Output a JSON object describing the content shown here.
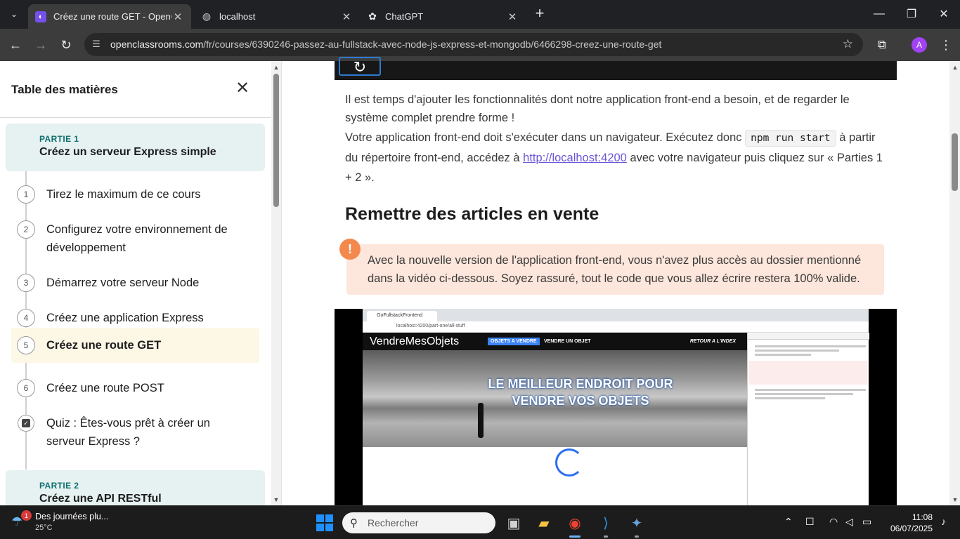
{
  "browser": {
    "tabs": [
      {
        "title": "Créez une route GET - OpenClassrooms",
        "active": true,
        "favicon": "openclassrooms-icon"
      },
      {
        "title": "localhost",
        "active": false,
        "favicon": "globe-icon"
      },
      {
        "title": "ChatGPT",
        "active": false,
        "favicon": "chatgpt-icon"
      }
    ],
    "url_host": "openclassrooms.com",
    "url_path": "/fr/courses/6390246-passez-au-fullstack-avec-node-js-express-et-mongodb/6466298-creez-une-route-get",
    "profile_initial": "A"
  },
  "sidebar": {
    "title": "Table des matières",
    "part1": {
      "label": "PARTIE 1",
      "title": "Créez un serveur Express simple"
    },
    "items": [
      {
        "num": "1",
        "label": "Tirez le maximum de ce cours"
      },
      {
        "num": "2",
        "label": "Configurez votre environnement de développement"
      },
      {
        "num": "3",
        "label": "Démarrez votre serveur Node"
      },
      {
        "num": "4",
        "label": "Créez une application Express"
      },
      {
        "num": "5",
        "label": "Créez une route GET",
        "current": true
      },
      {
        "num": "6",
        "label": "Créez une route POST"
      }
    ],
    "quiz_label": "Quiz : Êtes-vous prêt à créer un serveur Express ?",
    "part2": {
      "label": "PARTIE 2",
      "title": "Créez une API RESTful"
    }
  },
  "content": {
    "p1": "Il est temps d'ajouter les fonctionnalités dont notre application front-end a besoin, et de regarder le système complet prendre forme !",
    "p2_before": "Votre application front-end doit s'exécuter dans un navigateur. Exécutez donc",
    "p2_code": "npm run start",
    "p2_middle": "à partir du répertoire front-end, accédez à",
    "p2_link": "http://localhost:4200",
    "p2_after": "avec votre navigateur puis cliquez sur « Parties 1 + 2 ».",
    "heading": "Remettre des articles en vente",
    "alert": "Avec la nouvelle version de l'application front-end, vous n'avez plus accès au dossier mentionné dans la vidéo ci-dessous. Soyez rassuré, tout le code que vous allez écrire restera 100% valide."
  },
  "video": {
    "tab_title": "GoFullstackFrontend",
    "url": "localhost:4200/part-one/all-stuff",
    "brand": "VendreMesObjets",
    "nav_active": "OBJETS A VENDRE",
    "nav_item": "VENDRE UN OBJET",
    "nav_back": "RETOUR A L'INDEX",
    "hero_text": "LE MEILLEUR ENDROIT POUR VENDRE VOS OBJETS"
  },
  "taskbar": {
    "weather_title": "Des journées plu...",
    "weather_temp": "25°C",
    "weather_badge": "1",
    "search_placeholder": "Rechercher",
    "time": "11:08",
    "date": "06/07/2025"
  },
  "colors": {
    "accent_teal": "#0d6e6e",
    "alert_orange": "#f4894e",
    "link_purple": "#6b57d6"
  }
}
